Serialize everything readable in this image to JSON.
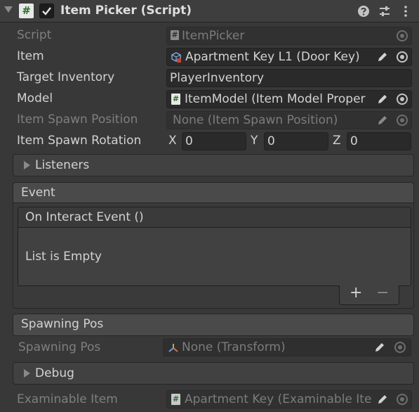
{
  "header": {
    "title": "Item Picker (Script)",
    "enabled": true
  },
  "fields": {
    "script": {
      "label": "Script",
      "value": "ItemPicker"
    },
    "item": {
      "label": "Item",
      "value": "Apartment Key L1 (Door Key)"
    },
    "target_inventory": {
      "label": "Target Inventory",
      "value": "PlayerInventory"
    },
    "model": {
      "label": "Model",
      "value": "ItemModel (Item Model Proper"
    },
    "item_spawn_position": {
      "label": "Item Spawn Position",
      "value": "None (Item Spawn Position)"
    },
    "item_spawn_rotation": {
      "label": "Item Spawn Rotation",
      "x_label": "X",
      "x": "0",
      "y_label": "Y",
      "y": "0",
      "z_label": "Z",
      "z": "0"
    },
    "examinable_item": {
      "label": "Examinable Item",
      "value": "Apartment Key (Examinable Ite"
    }
  },
  "sections": {
    "listeners": {
      "title": "Listeners"
    },
    "event": {
      "title": "Event",
      "list_title": "On Interact Event ()",
      "empty_text": "List is Empty",
      "add_label": "+",
      "remove_label": "−"
    },
    "spawning_pos": {
      "title": "Spawning Pos",
      "field_label": "Spawning Pos",
      "field_value": "None (Transform)"
    },
    "debug": {
      "title": "Debug"
    }
  }
}
